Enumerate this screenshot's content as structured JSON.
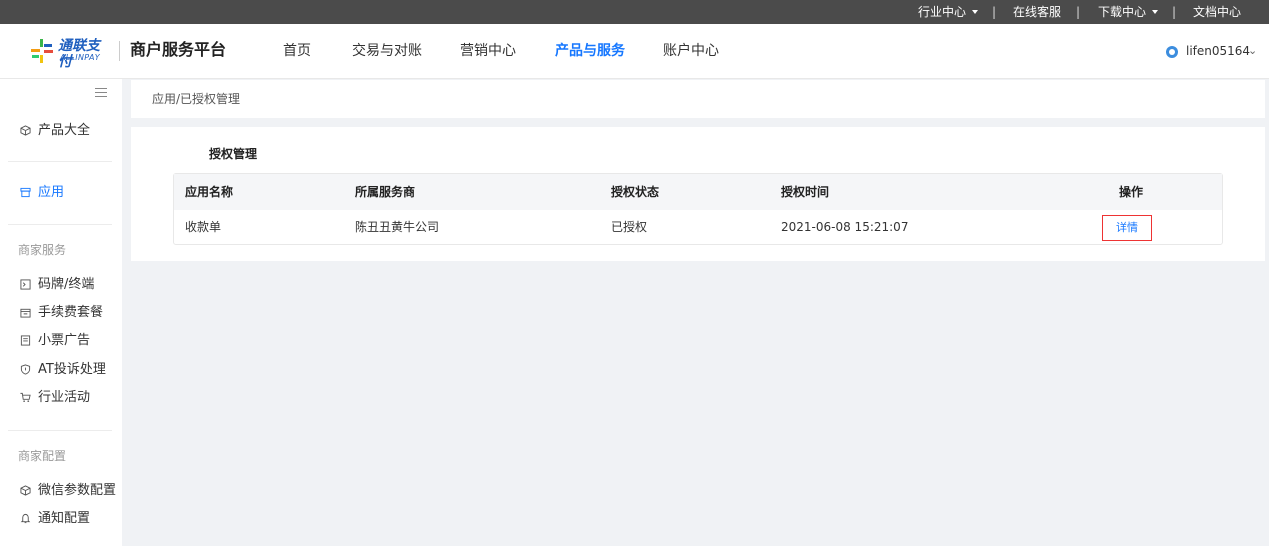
{
  "topbar": {
    "items": [
      "行业中心",
      "在线客服",
      "下载中心",
      "文档中心"
    ],
    "separator": "|"
  },
  "header": {
    "logo_cn": "通联支付",
    "logo_en": "ALLINPAY",
    "platform": "商户服务平台",
    "nav": [
      "首页",
      "交易与对账",
      "营销中心",
      "产品与服务",
      "账户中心"
    ],
    "active_nav": "产品与服务",
    "user": "lifen05164"
  },
  "sidebar": {
    "items_top": [
      "产品大全",
      "应用"
    ],
    "active": "应用",
    "group1_title": "商家服务",
    "group1": [
      "码牌/终端",
      "手续费套餐",
      "小票广告",
      "AT投诉处理",
      "行业活动"
    ],
    "group2_title": "商家配置",
    "group2": [
      "微信参数配置",
      "通知配置"
    ]
  },
  "breadcrumb": "应用/已授权管理",
  "content": {
    "title": "授权管理",
    "columns": [
      "应用名称",
      "所属服务商",
      "授权状态",
      "授权时间",
      "操作"
    ],
    "rows": [
      {
        "app": "收款单",
        "provider": "陈丑丑黄牛公司",
        "status": "已授权",
        "time": "2021-06-08 15:21:07",
        "action": "详情"
      }
    ]
  },
  "colors": {
    "accent": "#1677ff",
    "topbar": "#4b4b4b",
    "highlight_border": "#e33333"
  }
}
